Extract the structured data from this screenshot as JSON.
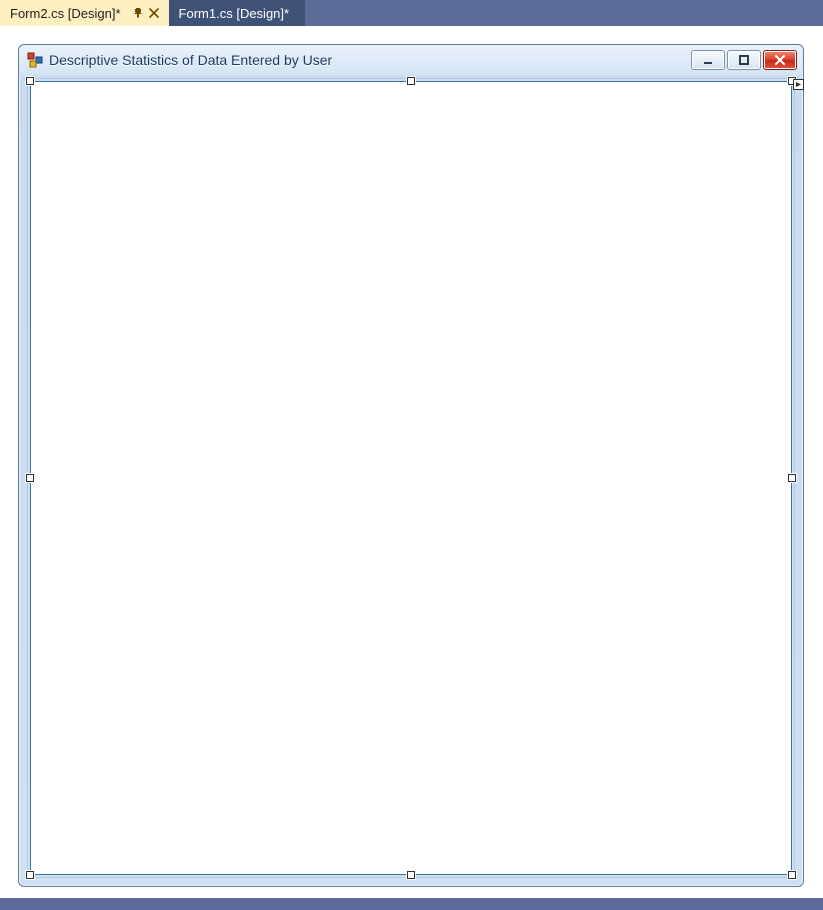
{
  "tabs": [
    {
      "label": "Form2.cs [Design]*",
      "active": true
    },
    {
      "label": "Form1.cs [Design]*",
      "active": false
    }
  ],
  "form": {
    "title": "Descriptive Statistics of Data Entered by User",
    "icon_name": "winforms-default-icon",
    "buttons": {
      "minimize": "Minimize",
      "maximize": "Maximize",
      "close": "Close"
    }
  },
  "colors": {
    "active_tab_bg": "#fff0c2",
    "inactive_tab_bg": "#3e5277",
    "shell_bg": "#5d6b99",
    "close_red": "#d9402a"
  }
}
